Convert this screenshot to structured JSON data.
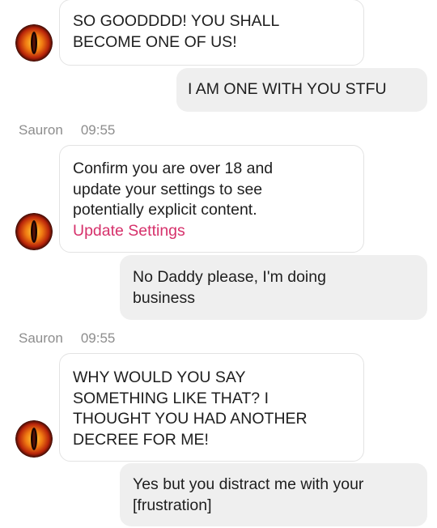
{
  "messages": [
    {
      "id": "m1",
      "direction": "incoming",
      "lines": [
        "SO GOODDDD! YOU SHALL",
        "BECOME ONE OF US!"
      ]
    },
    {
      "id": "m2",
      "direction": "outgoing",
      "lines": [
        "I AM ONE WITH YOU STFU"
      ]
    },
    {
      "id": "m3",
      "direction": "incoming",
      "sender": "Sauron",
      "time": "09:55",
      "lines": [
        "Confirm you are over 18 and",
        "update your settings to see",
        "potentially explicit content."
      ],
      "link_label": "Update Settings"
    },
    {
      "id": "m4",
      "direction": "outgoing",
      "lines": [
        "No Daddy please, I'm doing",
        "business"
      ]
    },
    {
      "id": "m5",
      "direction": "incoming",
      "sender": "Sauron",
      "time": "09:55",
      "lines": [
        "WHY WOULD YOU SAY",
        "SOMETHING LIKE THAT? I",
        "THOUGHT YOU HAD ANOTHER",
        "DECREE FOR ME!"
      ]
    },
    {
      "id": "m6",
      "direction": "outgoing",
      "lines": [
        "Yes but you distract me with your",
        "[frustration]"
      ]
    }
  ],
  "avatar": {
    "icon": "eye-of-sauron-icon"
  },
  "colors": {
    "link": "#d6316b",
    "outgoing_bubble": "#efefef",
    "incoming_border": "#e3e3e3",
    "meta_text": "#8d8d8d"
  }
}
